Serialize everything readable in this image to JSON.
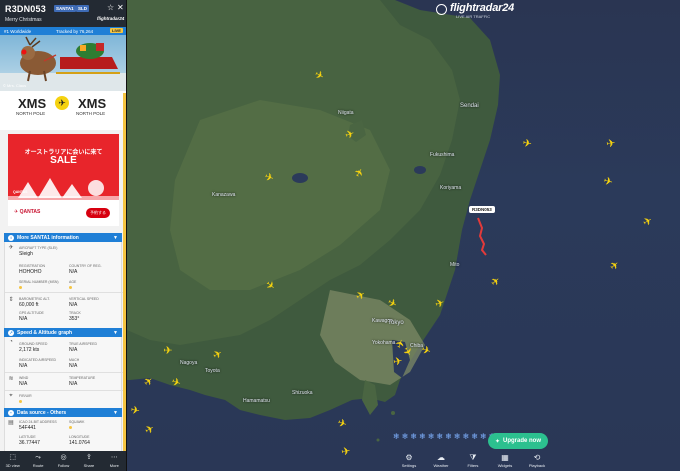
{
  "app": {
    "brand": "flightradar24",
    "brand_sub": "LIVE AIR TRAFFIC"
  },
  "flight": {
    "callsign": "R3DN053",
    "tags": [
      "SANTA1",
      "SLD"
    ],
    "subtitle": "Merry Christmas",
    "brand_small": "flightradar24",
    "rank_text": "#1 Worldwide",
    "tracked_text": "Tracked by 76,264",
    "badge": "LIVE",
    "photo_credit": "© Mrs. Claus",
    "map_label": "R3DN053"
  },
  "route": {
    "origin": {
      "code": "XMS",
      "place": "NORTH POLE",
      "time": ""
    },
    "destination": {
      "code": "XMS",
      "place": "NORTH POLE",
      "time": ""
    }
  },
  "ad": {
    "headline_jp": "オーストラリアに会いに来て",
    "headline": "SALE",
    "brand": "QANTAS",
    "cta": "予約する"
  },
  "sections": {
    "info_title": "More SANTA1 information",
    "speed_title": "Speed & Altitude graph",
    "source_title": "Data source - Others"
  },
  "details": {
    "aircraft_type_k": "AIRCRAFT TYPE (SLEI)",
    "aircraft_type_v": "Sleigh",
    "registration_k": "REGISTRATION",
    "registration_v": "HOHOHO",
    "country_k": "COUNTRY OF REG.",
    "country_v": "N/A",
    "serial_k": "SERIAL NUMBER (MSN)",
    "age_k": "AGE",
    "baro_k": "BAROMETRIC ALT.",
    "baro_v": "60,000 ft",
    "vspeed_k": "VERTICAL SPEED",
    "vspeed_v": "N/A",
    "gps_k": "GPS ALTITUDE",
    "gps_v": "N/A",
    "track_k": "TRACK",
    "track_v": "353°",
    "gspeed_k": "GROUND SPEED",
    "gspeed_v": "2,172 kts",
    "tas_k": "TRUE AIRSPEED",
    "tas_v": "N/A",
    "ias_k": "INDICATED AIRSPEED",
    "ias_v": "N/A",
    "mach_k": "MACH",
    "mach_v": "N/A",
    "wind_k": "WIND",
    "wind_v": "N/A",
    "temp_k": "TEMPERATURE",
    "temp_v": "N/A",
    "fir_k": "FIR/UIR",
    "icao_k": "ICAO 24-BIT ADDRESS",
    "icao_v": "54F441",
    "squawk_k": "SQUAWK",
    "lat_k": "LATITUDE",
    "lat_v": "36.77447",
    "lon_k": "LONGITUDE",
    "lon_v": "141.0764"
  },
  "bottom_nav": [
    {
      "label": "3D view",
      "icon": "cube-icon"
    },
    {
      "label": "Route",
      "icon": "route-icon"
    },
    {
      "label": "Follow",
      "icon": "follow-icon"
    },
    {
      "label": "Share",
      "icon": "share-icon"
    },
    {
      "label": "More",
      "icon": "more-icon"
    }
  ],
  "map": {
    "upgrade_label": "Upgrade now",
    "cities": {
      "sendai": "Sendai",
      "fukushima": "Fukushima",
      "koriyama": "Koriyama",
      "tokyo": "Tokyo",
      "yokohama": "Yokohama",
      "chiba": "Chiba",
      "kawagoe": "Kawagoe",
      "hamamatsu": "Hamamatsu",
      "shizuoka": "Shizuoka",
      "nagoya": "Nagoya",
      "toyota": "Toyota",
      "niigata": "Niigata",
      "kanazawa": "Kanazawa",
      "mito": "Mito"
    },
    "toolbar": [
      {
        "label": "Settings",
        "icon": "gear-icon"
      },
      {
        "label": "Weather",
        "icon": "weather-icon"
      },
      {
        "label": "Filters",
        "icon": "filter-icon"
      },
      {
        "label": "Widgets",
        "icon": "widgets-icon"
      },
      {
        "label": "Playback",
        "icon": "playback-icon"
      }
    ]
  },
  "colors": {
    "accent": "#1f7fd6",
    "plane": "#f5d210",
    "panel_header": "#232a33",
    "upgrade": "#2cc08f"
  }
}
